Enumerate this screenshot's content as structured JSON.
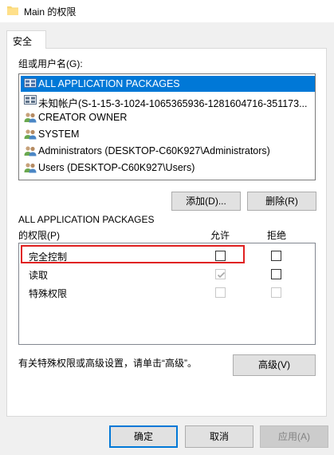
{
  "window": {
    "title": "Main 的权限",
    "folder_icon": "folder-icon"
  },
  "tabs": [
    {
      "label": "安全"
    }
  ],
  "groups": {
    "label": "组或用户名(G):",
    "items": [
      {
        "label": "ALL APPLICATION PACKAGES",
        "icon": "app-packages-icon",
        "selected": true
      },
      {
        "label": "未知帐户(S-1-15-3-1024-1065365936-1281604716-351173...",
        "icon": "unknown-account-icon",
        "selected": false
      },
      {
        "label": "CREATOR OWNER",
        "icon": "users-group-icon",
        "selected": false
      },
      {
        "label": "SYSTEM",
        "icon": "users-group-icon",
        "selected": false
      },
      {
        "label": "Administrators (DESKTOP-C60K927\\Administrators)",
        "icon": "users-group-icon",
        "selected": false
      },
      {
        "label": "Users (DESKTOP-C60K927\\Users)",
        "icon": "users-group-icon",
        "selected": false
      }
    ],
    "add_button": "添加(D)...",
    "remove_button": "删除(R)"
  },
  "permissions": {
    "for_label": "ALL APPLICATION PACKAGES",
    "title_label": "的权限(P)",
    "allow_header": "允许",
    "deny_header": "拒绝",
    "rows": [
      {
        "name": "完全控制",
        "allow": false,
        "allow_disabled": false,
        "deny": false,
        "deny_disabled": false,
        "highlighted": true
      },
      {
        "name": "读取",
        "allow": true,
        "allow_disabled": true,
        "deny": false,
        "deny_disabled": false,
        "highlighted": false
      },
      {
        "name": "特殊权限",
        "allow": false,
        "allow_disabled": true,
        "deny": false,
        "deny_disabled": true,
        "highlighted": false
      }
    ],
    "highlight_color": "#e02020"
  },
  "advanced": {
    "hint": "有关特殊权限或高级设置，请单击“高级”。",
    "button": "高级(V)"
  },
  "footer": {
    "ok": "确定",
    "cancel": "取消",
    "apply": "应用(A)"
  },
  "colors": {
    "accent": "#0078d7",
    "panel_bg": "#ffffff",
    "window_bg": "#f0f0f0"
  }
}
